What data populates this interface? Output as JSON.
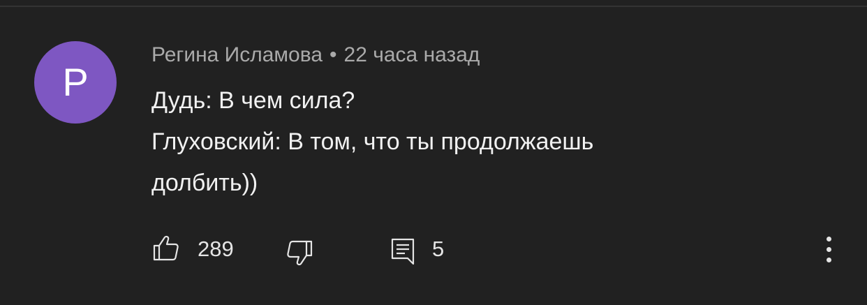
{
  "comment": {
    "avatar_letter": "P",
    "avatar_color": "#7e57c2",
    "author": "Регина Исламова",
    "separator": "•",
    "timestamp": "22 часа назад",
    "lines": [
      "Дудь: В чем сила?",
      "Глуховский: В том, что ты продолжаешь",
      "долбить))"
    ]
  },
  "actions": {
    "like_icon": "thumb-up-icon",
    "like_count": "289",
    "dislike_icon": "thumb-down-icon",
    "replies_icon": "comment-icon",
    "reply_count": "5",
    "more_icon": "more-vertical-icon"
  },
  "colors": {
    "background": "#212121",
    "text_primary": "#f1f1f1",
    "text_secondary": "#aaaaaa"
  }
}
